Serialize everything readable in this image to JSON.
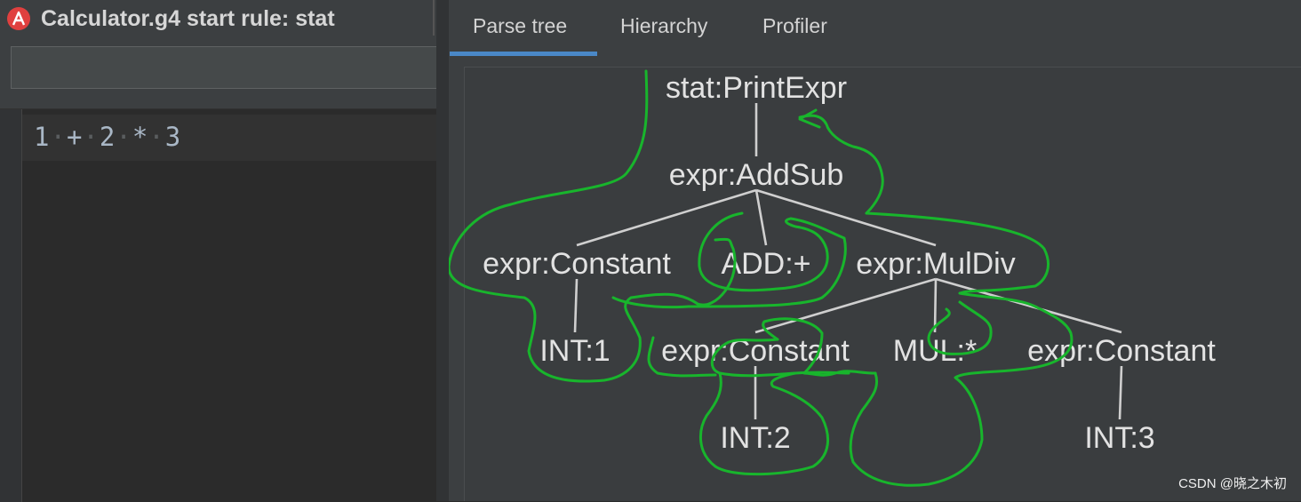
{
  "window": {
    "title": "Calculator.g4 start rule: stat",
    "logo_letter": "A"
  },
  "input": {
    "value": ""
  },
  "editor": {
    "tokens": [
      "1",
      "+",
      "2",
      "*",
      "3"
    ]
  },
  "tabs": [
    {
      "label": "Parse tree",
      "active": true
    },
    {
      "label": "Hierarchy",
      "active": false
    },
    {
      "label": "Profiler",
      "active": false
    }
  ],
  "parse_tree": {
    "nodes": [
      {
        "id": "n0",
        "label": "stat:PrintExpr"
      },
      {
        "id": "n1",
        "label": "expr:AddSub"
      },
      {
        "id": "n2",
        "label": "expr:Constant"
      },
      {
        "id": "n3",
        "label": "ADD:+"
      },
      {
        "id": "n4",
        "label": "expr:MulDiv"
      },
      {
        "id": "n5",
        "label": "INT:1"
      },
      {
        "id": "n6",
        "label": "expr:Constant"
      },
      {
        "id": "n7",
        "label": "MUL:*"
      },
      {
        "id": "n8",
        "label": "expr:Constant"
      },
      {
        "id": "n9",
        "label": "INT:2"
      },
      {
        "id": "n10",
        "label": "INT:3"
      }
    ],
    "edges": [
      [
        "n0",
        "n1"
      ],
      [
        "n1",
        "n2"
      ],
      [
        "n1",
        "n3"
      ],
      [
        "n1",
        "n4"
      ],
      [
        "n2",
        "n5"
      ],
      [
        "n4",
        "n6"
      ],
      [
        "n4",
        "n7"
      ],
      [
        "n4",
        "n8"
      ],
      [
        "n6",
        "n9"
      ],
      [
        "n8",
        "n10"
      ]
    ]
  },
  "colors": {
    "annotation": "#18b52c",
    "tab_accent": "#4a88c7",
    "logo": "#e0403f"
  },
  "watermark": "CSDN @晓之木初"
}
